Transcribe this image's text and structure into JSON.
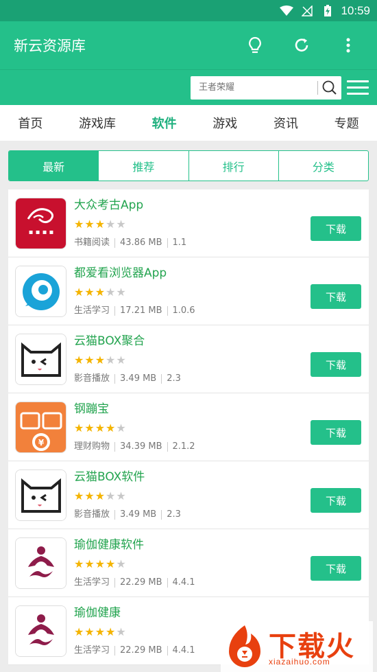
{
  "status_bar": {
    "time": "10:59"
  },
  "app_bar": {
    "title": "新云资源库"
  },
  "search": {
    "placeholder": "王者荣耀"
  },
  "nav_tabs": [
    "首页",
    "游戏库",
    "软件",
    "游戏",
    "资讯",
    "专题"
  ],
  "nav_active": "软件",
  "segments": [
    "最新",
    "推荐",
    "排行",
    "分类"
  ],
  "segment_active": "最新",
  "download_label": "下载",
  "apps": [
    {
      "name": "大众考古App",
      "rating": 3,
      "category": "书籍阅读",
      "size": "43.86 MB",
      "version": "1.1",
      "icon": "archaeology-icon"
    },
    {
      "name": "都爱看浏览器App",
      "rating": 3,
      "category": "生活学习",
      "size": "17.21 MB",
      "version": "1.0.6",
      "icon": "browser-icon"
    },
    {
      "name": "云猫BOX聚合",
      "rating": 3,
      "category": "影音播放",
      "size": "3.49 MB",
      "version": "2.3",
      "icon": "cat-box-icon"
    },
    {
      "name": "钢蹦宝",
      "rating": 4,
      "category": "理财购物",
      "size": "34.39 MB",
      "version": "2.1.2",
      "icon": "coin-icon"
    },
    {
      "name": "云猫BOX软件",
      "rating": 3,
      "category": "影音播放",
      "size": "3.49 MB",
      "version": "2.3",
      "icon": "cat-box-icon"
    },
    {
      "name": "瑜伽健康软件",
      "rating": 4,
      "category": "生活学习",
      "size": "22.29 MB",
      "version": "4.4.1",
      "icon": "yoga-icon"
    },
    {
      "name": "瑜伽健康",
      "rating": 4,
      "category": "生活学习",
      "size": "22.29 MB",
      "version": "4.4.1",
      "icon": "yoga-icon"
    }
  ],
  "watermark": {
    "text": "下载火",
    "url": "xiazaihuo.com"
  },
  "colors": {
    "primary": "#24c08a",
    "status_bar": "#1aa174",
    "app_name": "#23a44f",
    "star": "#f4b400",
    "watermark": "#e8400f"
  }
}
